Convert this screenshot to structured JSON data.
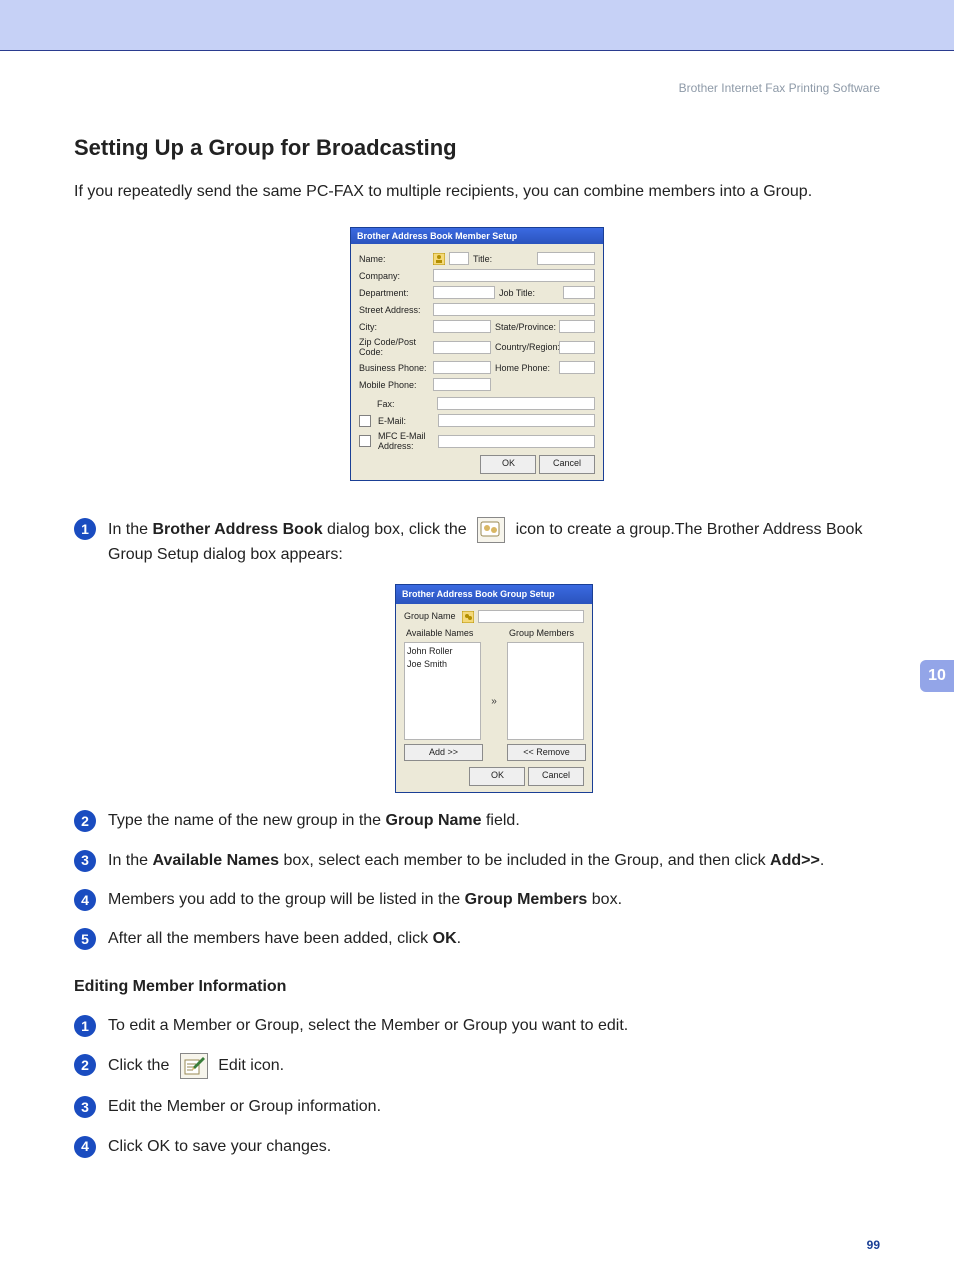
{
  "header": {
    "doc_title": "Brother Internet Fax Printing Software"
  },
  "section_title": "Setting Up a Group for Broadcasting",
  "intro": "If you repeatedly send the same PC-FAX to multiple recipients, you can combine members into a Group.",
  "dialog1": {
    "title": "Brother Address Book Member Setup",
    "labels": {
      "name": "Name:",
      "title": "Title:",
      "company": "Company:",
      "department": "Department:",
      "job_title": "Job Title:",
      "street": "Street Address:",
      "city": "City:",
      "state": "State/Province:",
      "zip": "Zip Code/Post Code:",
      "country": "Country/Region:",
      "bus_phone": "Business Phone:",
      "home_phone": "Home Phone:",
      "mobile": "Mobile Phone:",
      "fax": "Fax:",
      "email": "E-Mail:",
      "mfc_email": "MFC E-Mail Address:"
    },
    "buttons": {
      "ok": "OK",
      "cancel": "Cancel"
    }
  },
  "dialog2": {
    "title": "Brother Address Book Group Setup",
    "labels": {
      "group_name": "Group Name",
      "available": "Available Names",
      "members": "Group Members"
    },
    "available_list": [
      "John Roller",
      "Joe Smith"
    ],
    "arrow": "»",
    "buttons": {
      "add": "Add >>",
      "remove": "<< Remove",
      "ok": "OK",
      "cancel": "Cancel"
    }
  },
  "steps_a": {
    "s1_a": "In the ",
    "s1_bold1": "Brother Address Book",
    "s1_b": " dialog box, click the ",
    "s1_c": " icon to create a group.The Brother Address Book Group Setup dialog box appears:",
    "s2_a": "Type the name of the new group in the ",
    "s2_bold": "Group Name",
    "s2_b": " field.",
    "s3_a": "In the ",
    "s3_bold1": "Available Names",
    "s3_b": " box, select each member to be included in the Group, and then click ",
    "s3_bold2": "Add>>",
    "s3_c": ".",
    "s4_a": "Members you add to the group will be listed in the ",
    "s4_bold": "Group Members",
    "s4_b": " box.",
    "s5_a": "After all the members have been added, click ",
    "s5_bold": "OK",
    "s5_b": "."
  },
  "subhead": "Editing Member Information",
  "steps_b": {
    "s1": "To edit a Member or Group, select the Member or Group you want to edit.",
    "s2_a": "Click the ",
    "s2_b": " Edit icon.",
    "s3": "Edit the Member or Group information.",
    "s4": "Click OK to save your changes."
  },
  "chapter_number": "10",
  "page_number": "99"
}
